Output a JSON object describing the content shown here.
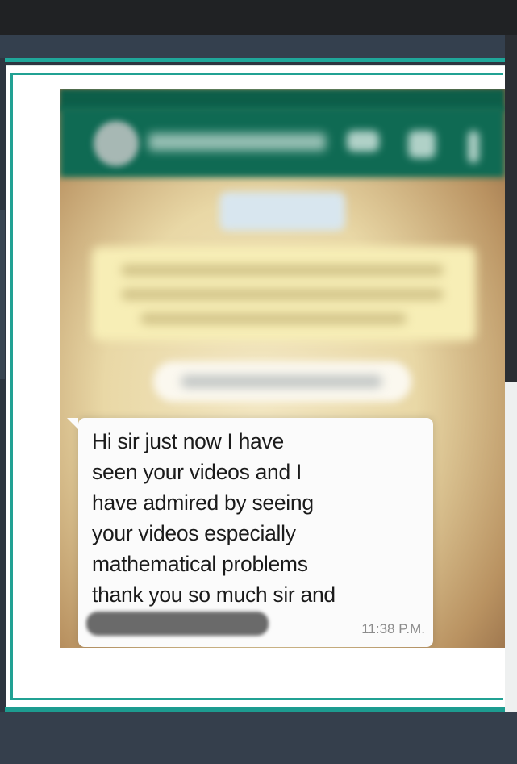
{
  "message": {
    "lines": [
      "Hi sir just now I have",
      "seen your videos and I",
      "have admired by seeing",
      "your videos especially",
      "mathematical problems",
      "thank you so much sir and"
    ],
    "timestamp": "11:38 P.M."
  },
  "colors": {
    "chat_header": "#0f6a53",
    "frame_accent": "#1fa79a",
    "bubble": "#fbfbfb"
  },
  "icons": [
    "video-call-icon",
    "voice-call-icon",
    "more-menu-icon"
  ]
}
